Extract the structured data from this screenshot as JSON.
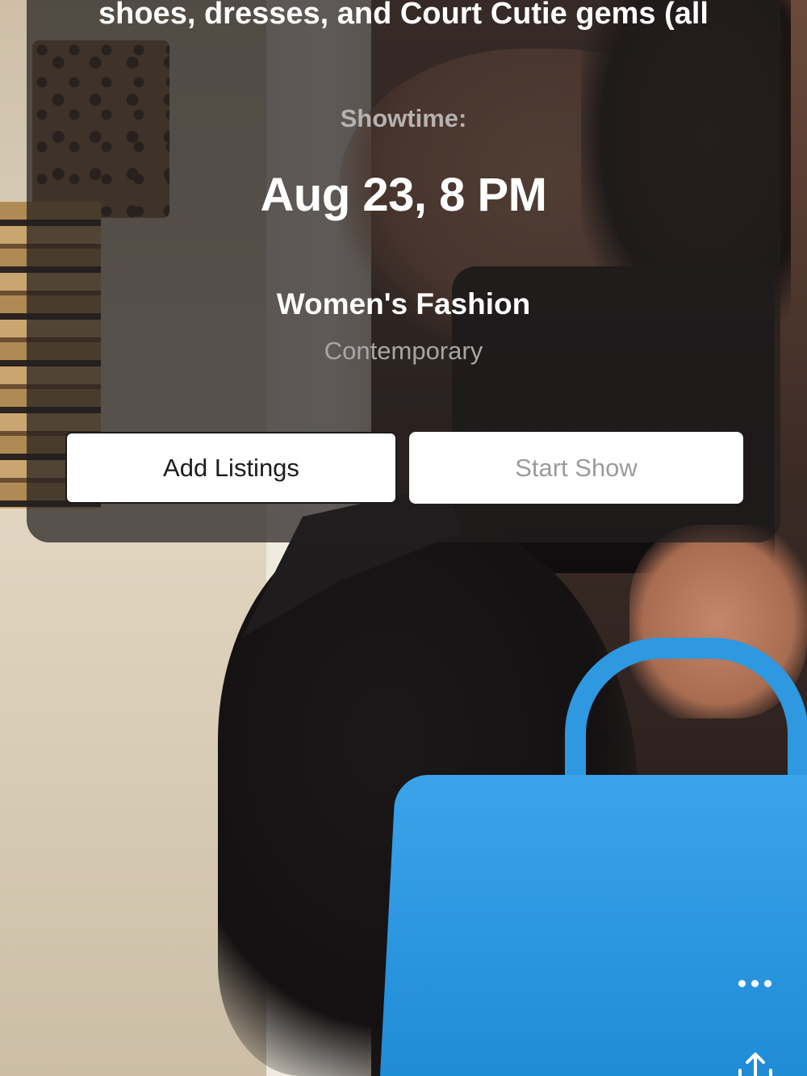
{
  "show": {
    "description_line": "shoes, dresses, and Court Cutie gems (all",
    "showtime_label": "Showtime:",
    "showtime_value": "Aug 23, 8 PM",
    "category": "Women's Fashion",
    "subcategory": "Contemporary"
  },
  "actions": {
    "add_listings_label": "Add Listings",
    "start_show_label": "Start Show"
  },
  "controls": {
    "more_icon": "more-horizontal-icon",
    "share_icon": "share-arrow-up-icon"
  },
  "colors": {
    "card_overlay": "#231e1e",
    "button_bg": "#ffffff",
    "disabled_text": "#9b9b9b",
    "muted_text": "#b6b2b0"
  }
}
